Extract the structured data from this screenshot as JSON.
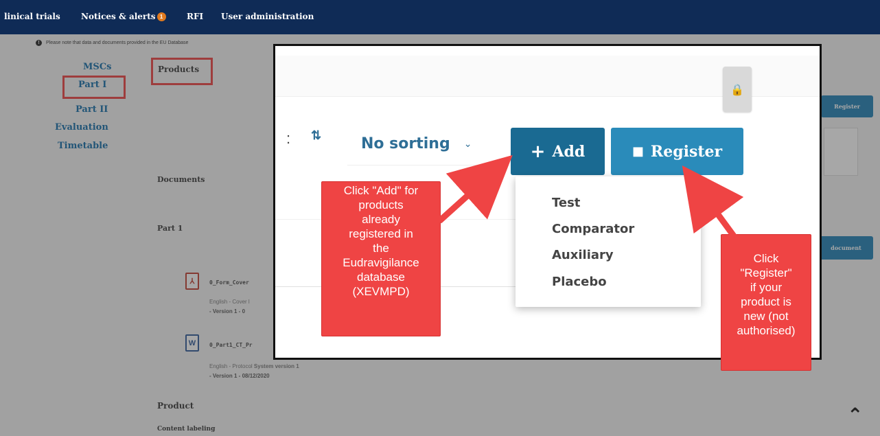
{
  "topnav": {
    "items": [
      {
        "label": "linical trials"
      },
      {
        "label": "Notices & alerts"
      },
      {
        "label": "RFI"
      },
      {
        "label": "User administration"
      }
    ],
    "badge_count": "1"
  },
  "note": "Please note that data and documents provided in the EU Database",
  "sidenav": {
    "items": [
      {
        "label": "MSCs"
      },
      {
        "label": "Part I"
      },
      {
        "label": "Part II"
      },
      {
        "label": "Evaluation"
      },
      {
        "label": "Timetable"
      }
    ]
  },
  "sections": {
    "products": "Products",
    "documents": "Documents",
    "part1": "Part 1",
    "product": "Product",
    "content_labeling": "Content labeling"
  },
  "documents": [
    {
      "name": "0_Form_Cover",
      "meta": "English - Cover l",
      "version": "- Version 1 - 0",
      "icon": "pdf-icon"
    },
    {
      "name": "0_Part1_CT_Pr",
      "meta": "English - Protocol   ",
      "meta_extra": "System version 1",
      "version": "- Version 1 - 08/12/2020",
      "icon": "word-icon"
    }
  ],
  "right_buttons": {
    "register": "Register",
    "document": "document"
  },
  "zoom": {
    "sort_value": "No sorting",
    "add_label": "Add",
    "register_label": "Register",
    "dropdown_options": [
      "Test",
      "Comparator",
      "Auxiliary",
      "Placebo"
    ]
  },
  "callouts": {
    "add": "Click \"Add\" for\nproducts\nalready\nregistered in\nthe\nEudravigilance\ndatabase\n(XEVMPD)",
    "register": "Click\n\"Register\"\nif your\nproduct is\nnew (not\nauthorised)"
  },
  "colors": {
    "nav_bg": "#0f2b56",
    "link": "#0e6aa8",
    "add_btn": "#1a6a92",
    "register_btn": "#2a8bba",
    "callout": "#ef4444",
    "highlight": "#ef3e3e"
  }
}
